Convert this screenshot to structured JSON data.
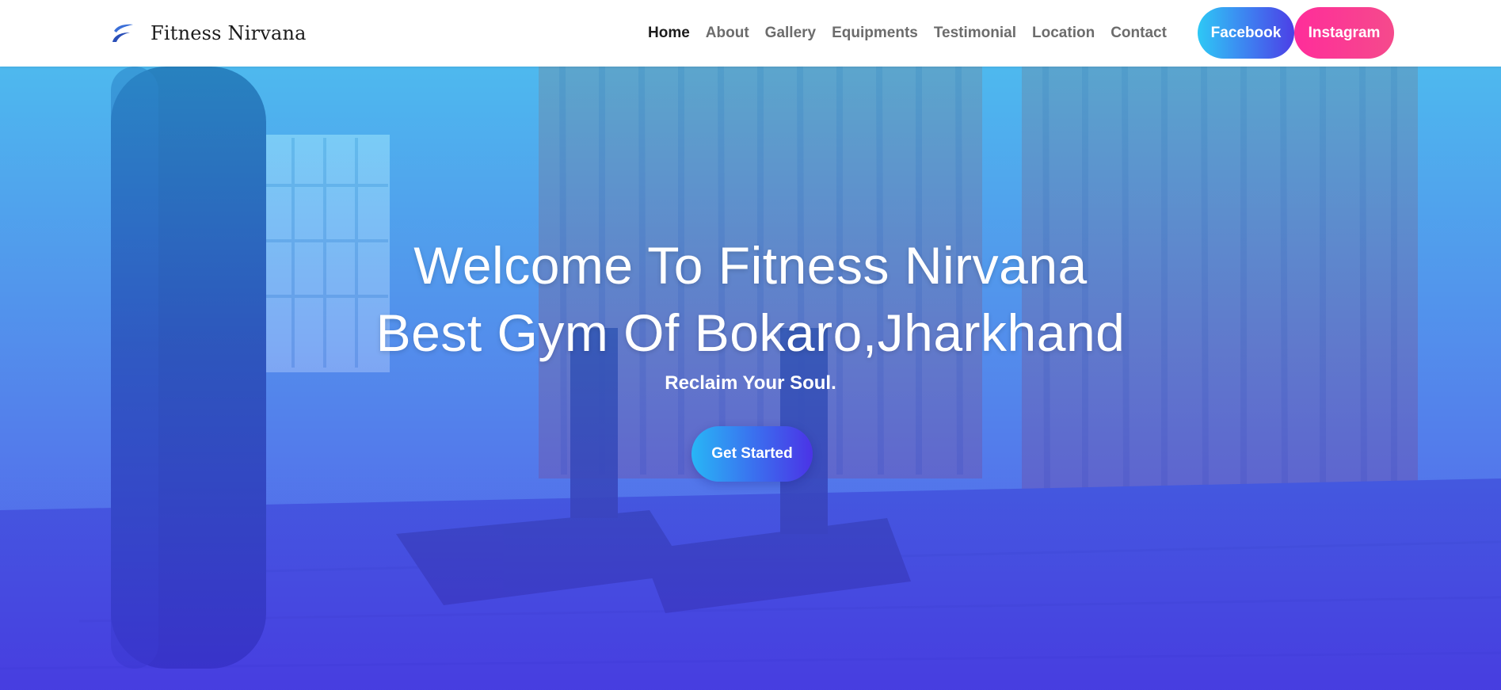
{
  "brand": {
    "name": "Fitness Nirvana",
    "logo_icon": "swoosh-logo-icon",
    "logo_color": "#3b6fd8"
  },
  "nav": {
    "items": [
      {
        "label": "Home",
        "active": true
      },
      {
        "label": "About"
      },
      {
        "label": "Gallery"
      },
      {
        "label": "Equipments"
      },
      {
        "label": "Testimonial"
      },
      {
        "label": "Location"
      },
      {
        "label": "Contact"
      }
    ],
    "facebook_label": "Facebook",
    "instagram_label": "Instagram"
  },
  "hero": {
    "title_line1": "Welcome To Fitness Nirvana",
    "title_line2": "Best Gym Of Bokaro,Jharkhand",
    "subtitle": "Reclaim Your Soul.",
    "cta_label": "Get Started"
  },
  "colors": {
    "facebook_gradient": [
      "#2ec8f5",
      "#4c3fe6"
    ],
    "instagram_gradient": [
      "#ff2d9a",
      "#f54a8c"
    ],
    "hero_overlay_top": "#32c8f5",
    "hero_overlay_bottom": "#4632eb"
  }
}
